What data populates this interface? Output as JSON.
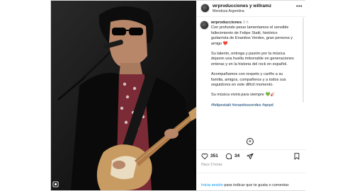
{
  "post": {
    "header": {
      "username": "wrproducciones y willramz",
      "location": "Mendoza Argentina",
      "more_icon": "•••"
    },
    "caption": {
      "username": "wrproducciones",
      "time": "3 h",
      "paragraphs": [
        "Con profundo pesar lamentamos el sensible fallecimiento de Felipe Staiti, histórico guitarrista de Enanitos Verdes, gran persona y amigo ❤️",
        "Su talento, entrega y pasión por la música dejaron una huella imborrable en generaciones enteras y en la historia del rock en español.",
        "Acompañamos con respeto y cariño a su familia, amigos, compañeros y a todos sus seguidores en este difícil momento.",
        "Su música vivirá para siempre 💚🎸"
      ],
      "hashtags": "#felipestaiti #enanitosverdes #qepd"
    },
    "actions": {
      "likes": "351",
      "comments": "34"
    },
    "date": "Hace 3 horas",
    "login": {
      "link": "Inicia sesión",
      "text": " para indicar que te gusta o comentar."
    }
  }
}
